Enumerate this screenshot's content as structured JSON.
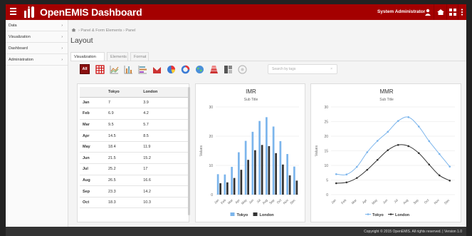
{
  "app": {
    "title": "OpenEMIS Dashboard",
    "user": "System Administrator"
  },
  "sidebar": {
    "items": [
      {
        "label": "Data"
      },
      {
        "label": "Visualization"
      },
      {
        "label": "Dashboard"
      },
      {
        "label": "Administration"
      }
    ]
  },
  "breadcrumb": {
    "items": [
      "Panel & Form Elements",
      "Panel"
    ]
  },
  "page": {
    "title": "Layout"
  },
  "tabs": [
    {
      "label": "Visualization",
      "active": true
    },
    {
      "label": "Elements"
    },
    {
      "label": "Format"
    }
  ],
  "toolbar": {
    "all_label": "All",
    "search_placeholder": "Search by tags"
  },
  "table": {
    "headers": [
      "",
      "Tokyo",
      "London"
    ],
    "rows": [
      [
        "Jan",
        "7",
        "3.9"
      ],
      [
        "Feb",
        "6.9",
        "4.2"
      ],
      [
        "Mar",
        "9.5",
        "5.7"
      ],
      [
        "Apr",
        "14.5",
        "8.5"
      ],
      [
        "May",
        "18.4",
        "11.9"
      ],
      [
        "Jun",
        "21.5",
        "15.2"
      ],
      [
        "Jul",
        "25.2",
        "17"
      ],
      [
        "Aug",
        "26.5",
        "16.6"
      ],
      [
        "Sep",
        "23.3",
        "14.2"
      ],
      [
        "Oct",
        "18.3",
        "10.3"
      ]
    ]
  },
  "chart_data": [
    {
      "type": "bar",
      "title": "IMR",
      "subtitle": "Sub Title",
      "ylabel": "Values",
      "ylim": [
        0,
        30
      ],
      "yticks": [
        "0",
        "10",
        "20",
        "30"
      ],
      "categories": [
        "Jan",
        "Feb",
        "Mar",
        "Apr",
        "May",
        "Jun",
        "Jul",
        "Aug",
        "Sep",
        "Oct",
        "Nov",
        "Dec"
      ],
      "series": [
        {
          "name": "Tokyo",
          "color": "#7cb5ec",
          "values": [
            7,
            6.9,
            9.5,
            14.5,
            18.4,
            21.5,
            25.2,
            26.5,
            23.3,
            18.3,
            13.9,
            9.6
          ]
        },
        {
          "name": "London",
          "color": "#333333",
          "values": [
            3.9,
            4.2,
            5.7,
            8.5,
            11.9,
            15.2,
            17,
            16.6,
            14.2,
            10.3,
            6.6,
            4.8
          ]
        }
      ]
    },
    {
      "type": "line",
      "title": "MMR",
      "subtitle": "Sub Title",
      "ylabel": "Values",
      "ylim": [
        0,
        30
      ],
      "yticks": [
        "0",
        "5",
        "10",
        "15",
        "20",
        "25",
        "30"
      ],
      "categories": [
        "Jan",
        "Feb",
        "Mar",
        "Apr",
        "May",
        "Jun",
        "Jul",
        "Aug",
        "Sep",
        "Oct",
        "Nov",
        "Dec"
      ],
      "series": [
        {
          "name": "Tokyo",
          "color": "#7cb5ec",
          "values": [
            7,
            6.9,
            9.5,
            14.5,
            18.4,
            21.5,
            25.2,
            26.5,
            23.3,
            18.3,
            13.9,
            9.6
          ]
        },
        {
          "name": "London",
          "color": "#333333",
          "values": [
            3.9,
            4.2,
            5.7,
            8.5,
            11.9,
            15.2,
            17,
            16.6,
            14.2,
            10.3,
            6.6,
            4.8
          ]
        }
      ]
    }
  ],
  "footer": {
    "text": "Copyright © 2015 OpenEMIS. All rights reserved. | Version 1.0"
  },
  "colors": {
    "brand": "#a40000",
    "accent_blue": "#7cb5ec",
    "dark_series": "#333333"
  }
}
